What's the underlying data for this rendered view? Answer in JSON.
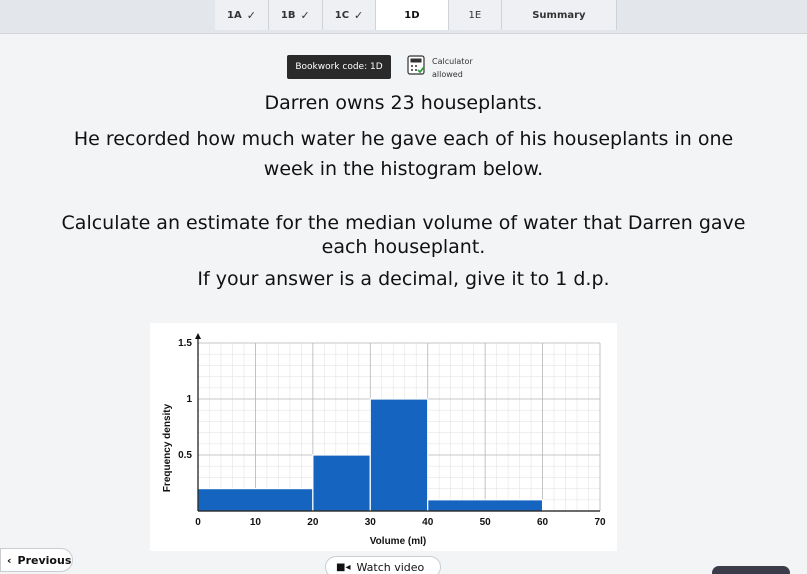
{
  "tabs": [
    {
      "label": "1A",
      "done": true
    },
    {
      "label": "1B",
      "done": true
    },
    {
      "label": "1C",
      "done": true
    },
    {
      "label": "1D",
      "done": false
    },
    {
      "label": "1E",
      "done": false
    },
    {
      "label": "Summary",
      "done": false
    }
  ],
  "bookwork": {
    "label": "Bookwork code: 1D"
  },
  "calculator": {
    "line1": "Calculator",
    "line2": "allowed"
  },
  "question": {
    "line1": "Darren owns 23 houseplants.",
    "line2": "He recorded how much water he gave each of his houseplants in one",
    "line3": "week in the histogram below.",
    "line4": "Calculate an estimate for the median volume of water that Darren gave",
    "line5": "each houseplant.",
    "line6": "If your answer is a decimal, give it to 1 d.p."
  },
  "chart_data": {
    "type": "bar",
    "xlabel": "Volume (ml)",
    "ylabel": "Frequency density",
    "xlim": [
      0,
      70
    ],
    "ylim": [
      0,
      1.5
    ],
    "x_ticks": [
      "0",
      "10",
      "20",
      "30",
      "40",
      "50",
      "60",
      "70"
    ],
    "y_ticks": [
      "0.5",
      "1",
      "1.5"
    ],
    "bins": [
      {
        "from": 0,
        "to": 20,
        "density": 0.2
      },
      {
        "from": 20,
        "to": 30,
        "density": 0.5
      },
      {
        "from": 30,
        "to": 40,
        "density": 1.0
      },
      {
        "from": 40,
        "to": 60,
        "density": 0.1
      }
    ],
    "bar_color": "#1565c0",
    "grid": true
  },
  "buttons": {
    "previous": "Previous",
    "watch_video": "Watch video"
  }
}
